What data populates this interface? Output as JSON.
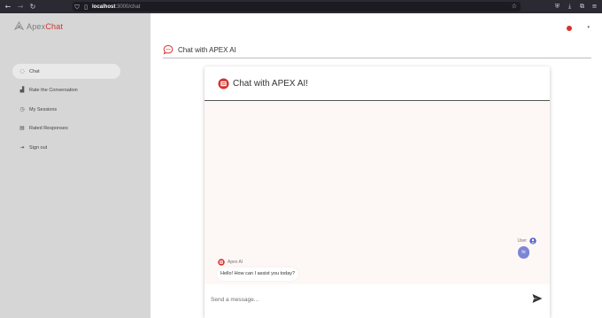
{
  "browser": {
    "url_host": "localhost",
    "url_path": ":3000/chat",
    "icons": [
      "back-icon",
      "forward-icon",
      "reload-icon",
      "shield-icon",
      "page-icon",
      "star-icon",
      "pocket-icon",
      "download-icon",
      "extensions-icon",
      "menu-icon"
    ]
  },
  "sidebar": {
    "logo_prefix": "Apex",
    "logo_suffix": "Chat",
    "items": [
      {
        "label": "Chat",
        "icon": "chat-bubble-icon",
        "active": true
      },
      {
        "label": "Rate the Conversation",
        "icon": "chart-icon",
        "active": false
      },
      {
        "label": "My Sessions",
        "icon": "clock-icon",
        "active": false
      },
      {
        "label": "Rated Responses",
        "icon": "document-icon",
        "active": false
      },
      {
        "label": "Sign out",
        "icon": "sign-out-icon",
        "active": false
      }
    ]
  },
  "header": {
    "title": "Chat with APEX AI"
  },
  "chat": {
    "card_title": "Chat with APEX AI!",
    "messages": [
      {
        "sender": "User",
        "text": "hi"
      },
      {
        "sender": "Apex AI",
        "text": "Hello! How can I assist you today?"
      }
    ],
    "input_placeholder": "Send a message..."
  },
  "colors": {
    "accent": "#d7322c",
    "sidebar_bg": "#d6d6d6",
    "user_bubble": "#7d85d6",
    "messages_bg": "#fdf8f5"
  }
}
